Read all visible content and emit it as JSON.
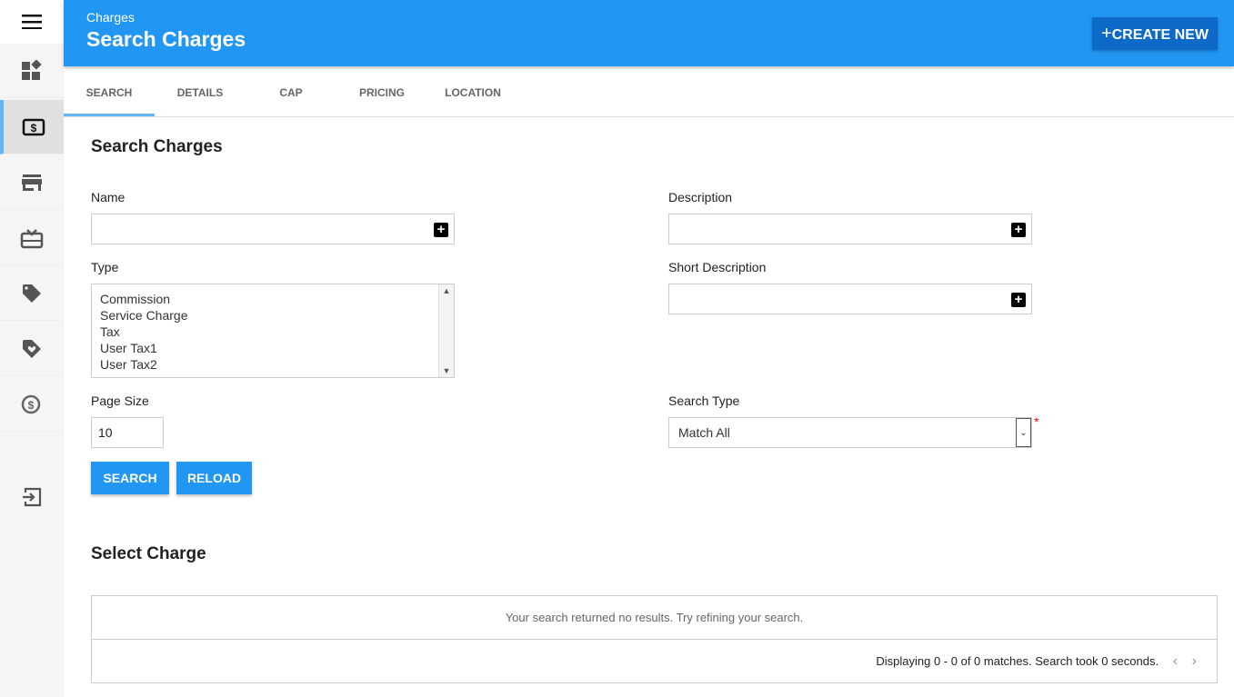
{
  "sidebar": {
    "items": [
      {
        "icon": "menu-icon"
      },
      {
        "icon": "dashboard-icon"
      },
      {
        "icon": "dollar-icon",
        "active": true
      },
      {
        "icon": "store-icon"
      },
      {
        "icon": "gift-card-icon"
      },
      {
        "icon": "tag-icon"
      },
      {
        "icon": "tag-heart-icon"
      },
      {
        "icon": "currency-exchange-icon"
      },
      {
        "icon": "logout-icon"
      }
    ]
  },
  "header": {
    "subtitle": "Charges",
    "title": "Search Charges",
    "create_label": "CREATE NEW"
  },
  "tabs": [
    {
      "label": "SEARCH",
      "active": true
    },
    {
      "label": "DETAILS"
    },
    {
      "label": "CAP"
    },
    {
      "label": "PRICING"
    },
    {
      "label": "LOCATION"
    }
  ],
  "form": {
    "title": "Search Charges",
    "name_label": "Name",
    "name_value": "",
    "description_label": "Description",
    "description_value": "",
    "type_label": "Type",
    "type_options": [
      "Commission",
      "Service Charge",
      "Tax",
      "User Tax1",
      "User Tax2"
    ],
    "short_description_label": "Short Description",
    "short_description_value": "",
    "page_size_label": "Page Size",
    "page_size_value": "10",
    "search_type_label": "Search Type",
    "search_type_value": "Match All",
    "required_mark": "*",
    "search_label": "SEARCH",
    "reload_label": "RELOAD"
  },
  "results": {
    "title": "Select Charge",
    "empty_message": "Your search returned no results. Try refining your search.",
    "status": "Displaying 0 - 0 of 0 matches. Search took 0 seconds.",
    "prev": "‹",
    "next": "›"
  },
  "colors": {
    "accent": "#2196f3",
    "create_button": "#0d6bc7",
    "active_tab": "#64b5f6"
  }
}
